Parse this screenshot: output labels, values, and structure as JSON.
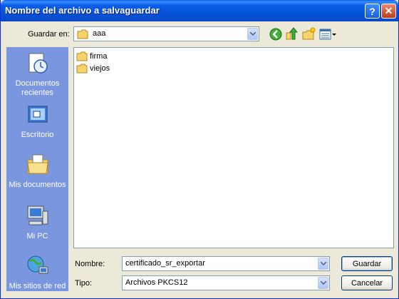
{
  "dialog": {
    "title": "Nombre del archivo a salvaguardar",
    "help_label": "?",
    "close_label": "✕"
  },
  "location": {
    "label": "Guardar en:",
    "value": "aaa"
  },
  "places": [
    {
      "label": "Documentos recientes"
    },
    {
      "label": "Escritorio"
    },
    {
      "label": "Mis documentos"
    },
    {
      "label": "Mi PC"
    },
    {
      "label": "Mis sitios de red"
    }
  ],
  "files": [
    {
      "name": "firma"
    },
    {
      "name": "viejos"
    }
  ],
  "filename": {
    "label": "Nombre:",
    "value": "certificado_sr_exportar"
  },
  "filetype": {
    "label": "Tipo:",
    "value": "Archivos PKCS12"
  },
  "buttons": {
    "save": "Guardar",
    "cancel": "Cancelar"
  }
}
